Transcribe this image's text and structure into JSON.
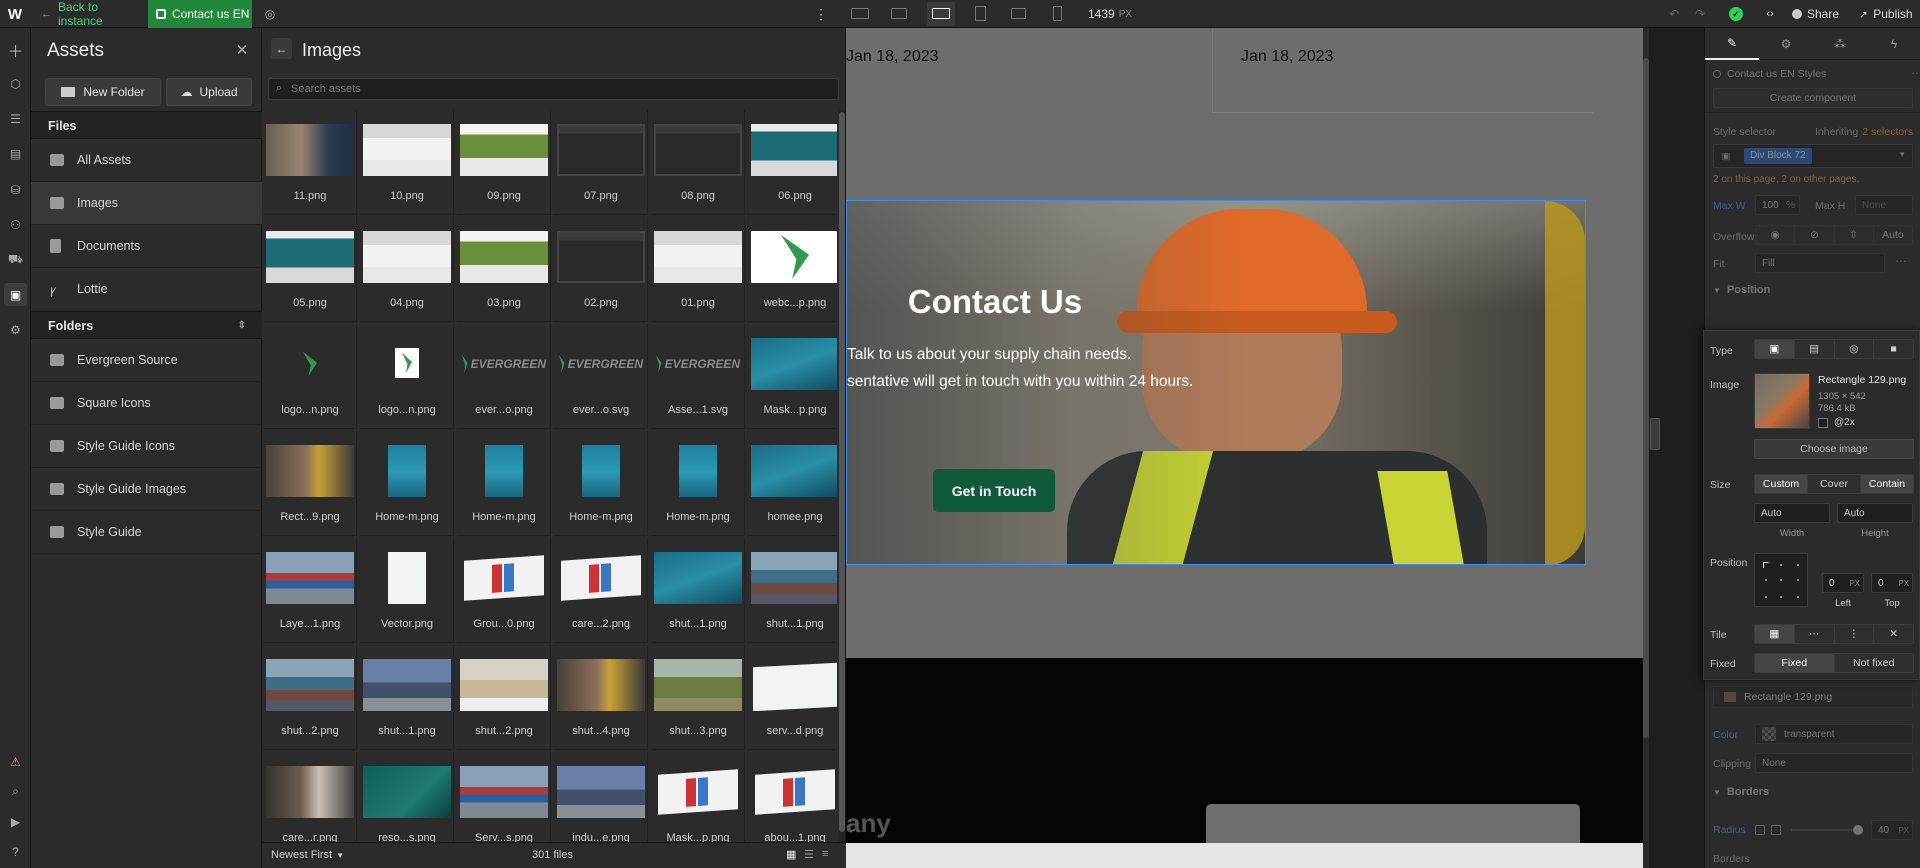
{
  "topbar": {
    "back_label": "Back to instance",
    "page_label": "Contact us EN",
    "width_value": "1439",
    "width_unit": "PX",
    "share_label": "Share",
    "publish_label": "Publish",
    "status_color": "#2bd158",
    "page_badge_color": "#21873a"
  },
  "assets": {
    "title": "Assets",
    "new_folder_label": "New Folder",
    "upload_label": "Upload",
    "files_header": "Files",
    "files": [
      "All Assets",
      "Images",
      "Documents",
      "Lottie"
    ],
    "folders_header": "Folders",
    "folders": [
      "Evergreen Source",
      "Square Icons",
      "Style Guide Icons",
      "Style Guide Images",
      "Style Guide"
    ]
  },
  "images": {
    "title": "Images",
    "search_placeholder": "Search assets",
    "sort_label": "Newest First",
    "count_label": "301 files",
    "tiles": [
      {
        "name": "11.png",
        "thumb": "photo"
      },
      {
        "name": "10.png",
        "thumb": "web-white"
      },
      {
        "name": "09.png",
        "thumb": "web-green"
      },
      {
        "name": "07.png",
        "thumb": "web-dark"
      },
      {
        "name": "08.png",
        "thumb": "web-dark"
      },
      {
        "name": "06.png",
        "thumb": "web-ship"
      },
      {
        "name": "05.png",
        "thumb": "web-ship"
      },
      {
        "name": "04.png",
        "thumb": "web-white"
      },
      {
        "name": "03.png",
        "thumb": "web-green"
      },
      {
        "name": "02.png",
        "thumb": "web-dark"
      },
      {
        "name": "01.png",
        "thumb": "web-white"
      },
      {
        "name": "webc...p.png",
        "thumb": "logo-large"
      },
      {
        "name": "logo...n.png",
        "thumb": "logo-small"
      },
      {
        "name": "logo...n.png",
        "thumb": "logo-box"
      },
      {
        "name": "ever...o.png",
        "thumb": "evergreen"
      },
      {
        "name": "ever...o.svg",
        "thumb": "evergreen"
      },
      {
        "name": "Asse...1.svg",
        "thumb": "evergreen"
      },
      {
        "name": "Mask...p.png",
        "thumb": "ship"
      },
      {
        "name": "Rect...9.png",
        "thumb": "worker"
      },
      {
        "name": "Home-m.png",
        "thumb": "ship-tall"
      },
      {
        "name": "Home-m.png",
        "thumb": "ship-tall"
      },
      {
        "name": "Home-m.png",
        "thumb": "ship-tall"
      },
      {
        "name": "Home-m.png",
        "thumb": "ship-tall"
      },
      {
        "name": "homee.png",
        "thumb": "ship"
      },
      {
        "name": "Laye...1.png",
        "thumb": "containers"
      },
      {
        "name": "Vector.png",
        "thumb": "white-tall"
      },
      {
        "name": "Grou...0.png",
        "thumb": "containers-white"
      },
      {
        "name": "care...2.png",
        "thumb": "containers-white"
      },
      {
        "name": "shut...1.png",
        "thumb": "ship"
      },
      {
        "name": "shut...1.png",
        "thumb": "port"
      },
      {
        "name": "shut...2.png",
        "thumb": "port"
      },
      {
        "name": "shut...1.png",
        "thumb": "city"
      },
      {
        "name": "shut...2.png",
        "thumb": "warehouse"
      },
      {
        "name": "shut...4.png",
        "thumb": "worker"
      },
      {
        "name": "shut...3.png",
        "thumb": "field"
      },
      {
        "name": "serv...d.png",
        "thumb": "white"
      },
      {
        "name": "care...r.png",
        "thumb": "office"
      },
      {
        "name": "reso...s.png",
        "thumb": "plane"
      },
      {
        "name": "Serv...s.png",
        "thumb": "containers"
      },
      {
        "name": "indu...e.png",
        "thumb": "city"
      },
      {
        "name": "Mask...p.png",
        "thumb": "containers-white"
      },
      {
        "name": "abou...1.png",
        "thumb": "containers-white"
      }
    ]
  },
  "canvas": {
    "date_left": "Jan 18, 2023",
    "date_right": "Jan 18, 2023",
    "hero_title": "Contact Us",
    "hero_line1": "Talk to us about your supply chain needs.",
    "hero_line2": "sentative will get in touch with you within 24 hours.",
    "cta_label": "Get in Touch",
    "footer_text": "any",
    "cta_color": "#0e5a3a"
  },
  "style_panel": {
    "styles_label": "Contact us EN Styles",
    "create_component_label": "Create component",
    "style_selector_label": "Style selector",
    "inheriting_label": "Inheriting",
    "inheriting_count": "2 selectors",
    "selector_chip": "Div Block 72",
    "selector_note": "2 on this page, 2 on other pages.",
    "max_w_label": "Max W",
    "max_w_value": "100",
    "max_w_unit": "%",
    "max_h_label": "Max H",
    "max_h_value": "None",
    "overflow_label": "Overflow",
    "overflow_auto": "Auto",
    "fit_label": "Fit",
    "fit_value": "Fill",
    "position_header": "Position",
    "bg_file": "Rectangle 129.png",
    "color_label": "Color",
    "color_value": "transparent",
    "clipping_label": "Clipping",
    "clipping_value": "None",
    "borders_header": "Borders",
    "radius_label": "Radius",
    "radius_value": "40",
    "radius_unit": "PX",
    "borders_label": "Borders"
  },
  "bg_settings": {
    "type_label": "Type",
    "image_label": "Image",
    "image_name": "Rectangle 129.png",
    "image_dims": "1305 × 542",
    "image_size": "786.4 kB",
    "retina_label": "@2x",
    "choose_image_label": "Choose image",
    "size_label": "Size",
    "size_options": [
      "Custom",
      "Cover",
      "Contain"
    ],
    "width_value": "Auto",
    "height_value": "Auto",
    "width_caption": "Width",
    "height_caption": "Height",
    "position_label": "Position",
    "left_value": "0",
    "top_value": "0",
    "left_caption": "Left",
    "top_caption": "Top",
    "px_unit": "PX",
    "tile_label": "Tile",
    "fixed_label": "Fixed",
    "fixed_options": [
      "Fixed",
      "Not fixed"
    ]
  }
}
